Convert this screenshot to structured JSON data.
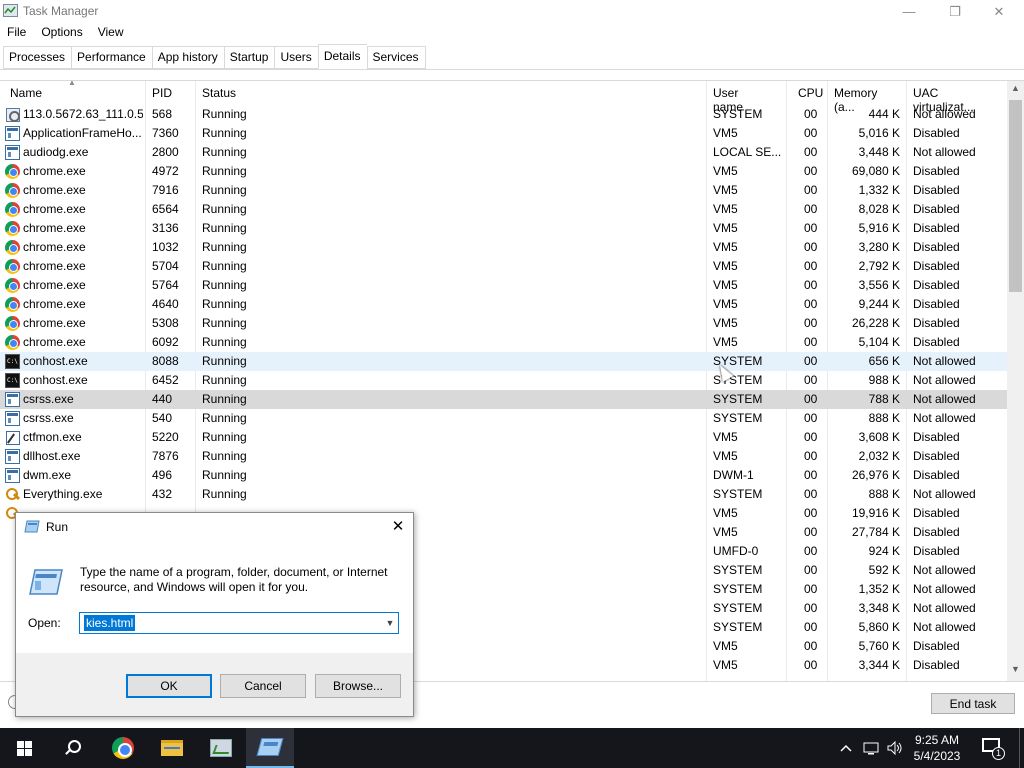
{
  "window": {
    "title": "Task Manager",
    "controls": {
      "minimize": "—",
      "maximize": "❐",
      "close": "✕"
    }
  },
  "menu": [
    "File",
    "Options",
    "View"
  ],
  "tabs": [
    "Processes",
    "Performance",
    "App history",
    "Startup",
    "Users",
    "Details",
    "Services"
  ],
  "active_tab": "Details",
  "columns": {
    "name": "Name",
    "pid": "PID",
    "status": "Status",
    "user": "User name",
    "cpu": "CPU",
    "memory": "Memory (a...",
    "uac": "UAC virtualizat..."
  },
  "rows": [
    {
      "icon": "gear",
      "name": "113.0.5672.63_111.0.5...",
      "pid": "568",
      "status": "Running",
      "user": "SYSTEM",
      "cpu": "00",
      "mem": "444 K",
      "uac": "Not allowed"
    },
    {
      "icon": "win",
      "name": "ApplicationFrameHo...",
      "pid": "7360",
      "status": "Running",
      "user": "VM5",
      "cpu": "00",
      "mem": "5,016 K",
      "uac": "Disabled"
    },
    {
      "icon": "win",
      "name": "audiodg.exe",
      "pid": "2800",
      "status": "Running",
      "user": "LOCAL SE...",
      "cpu": "00",
      "mem": "3,448 K",
      "uac": "Not allowed"
    },
    {
      "icon": "chrome",
      "name": "chrome.exe",
      "pid": "4972",
      "status": "Running",
      "user": "VM5",
      "cpu": "00",
      "mem": "69,080 K",
      "uac": "Disabled"
    },
    {
      "icon": "chrome",
      "name": "chrome.exe",
      "pid": "7916",
      "status": "Running",
      "user": "VM5",
      "cpu": "00",
      "mem": "1,332 K",
      "uac": "Disabled"
    },
    {
      "icon": "chrome",
      "name": "chrome.exe",
      "pid": "6564",
      "status": "Running",
      "user": "VM5",
      "cpu": "00",
      "mem": "8,028 K",
      "uac": "Disabled"
    },
    {
      "icon": "chrome",
      "name": "chrome.exe",
      "pid": "3136",
      "status": "Running",
      "user": "VM5",
      "cpu": "00",
      "mem": "5,916 K",
      "uac": "Disabled"
    },
    {
      "icon": "chrome",
      "name": "chrome.exe",
      "pid": "1032",
      "status": "Running",
      "user": "VM5",
      "cpu": "00",
      "mem": "3,280 K",
      "uac": "Disabled"
    },
    {
      "icon": "chrome",
      "name": "chrome.exe",
      "pid": "5704",
      "status": "Running",
      "user": "VM5",
      "cpu": "00",
      "mem": "2,792 K",
      "uac": "Disabled"
    },
    {
      "icon": "chrome",
      "name": "chrome.exe",
      "pid": "5764",
      "status": "Running",
      "user": "VM5",
      "cpu": "00",
      "mem": "3,556 K",
      "uac": "Disabled"
    },
    {
      "icon": "chrome",
      "name": "chrome.exe",
      "pid": "4640",
      "status": "Running",
      "user": "VM5",
      "cpu": "00",
      "mem": "9,244 K",
      "uac": "Disabled"
    },
    {
      "icon": "chrome",
      "name": "chrome.exe",
      "pid": "5308",
      "status": "Running",
      "user": "VM5",
      "cpu": "00",
      "mem": "26,228 K",
      "uac": "Disabled"
    },
    {
      "icon": "chrome",
      "name": "chrome.exe",
      "pid": "6092",
      "status": "Running",
      "user": "VM5",
      "cpu": "00",
      "mem": "5,104 K",
      "uac": "Disabled"
    },
    {
      "icon": "console",
      "name": "conhost.exe",
      "pid": "8088",
      "status": "Running",
      "user": "SYSTEM",
      "cpu": "00",
      "mem": "656 K",
      "uac": "Not allowed",
      "state": "hover"
    },
    {
      "icon": "console",
      "name": "conhost.exe",
      "pid": "6452",
      "status": "Running",
      "user": "SYSTEM",
      "cpu": "00",
      "mem": "988 K",
      "uac": "Not allowed"
    },
    {
      "icon": "win",
      "name": "csrss.exe",
      "pid": "440",
      "status": "Running",
      "user": "SYSTEM",
      "cpu": "00",
      "mem": "788 K",
      "uac": "Not allowed",
      "state": "selected"
    },
    {
      "icon": "win",
      "name": "csrss.exe",
      "pid": "540",
      "status": "Running",
      "user": "SYSTEM",
      "cpu": "00",
      "mem": "888 K",
      "uac": "Not allowed"
    },
    {
      "icon": "pen",
      "name": "ctfmon.exe",
      "pid": "5220",
      "status": "Running",
      "user": "VM5",
      "cpu": "00",
      "mem": "3,608 K",
      "uac": "Disabled"
    },
    {
      "icon": "win",
      "name": "dllhost.exe",
      "pid": "7876",
      "status": "Running",
      "user": "VM5",
      "cpu": "00",
      "mem": "2,032 K",
      "uac": "Disabled"
    },
    {
      "icon": "win",
      "name": "dwm.exe",
      "pid": "496",
      "status": "Running",
      "user": "DWM-1",
      "cpu": "00",
      "mem": "26,976 K",
      "uac": "Disabled"
    },
    {
      "icon": "key",
      "name": "Everything.exe",
      "pid": "432",
      "status": "Running",
      "user": "SYSTEM",
      "cpu": "00",
      "mem": "888 K",
      "uac": "Not allowed"
    },
    {
      "icon": "key",
      "name": "",
      "pid": "",
      "status": "",
      "user": "VM5",
      "cpu": "00",
      "mem": "19,916 K",
      "uac": "Disabled"
    },
    {
      "icon": "",
      "name": "",
      "pid": "",
      "status": "",
      "user": "VM5",
      "cpu": "00",
      "mem": "27,784 K",
      "uac": "Disabled"
    },
    {
      "icon": "",
      "name": "",
      "pid": "",
      "status": "",
      "user": "UMFD-0",
      "cpu": "00",
      "mem": "924 K",
      "uac": "Disabled"
    },
    {
      "icon": "",
      "name": "",
      "pid": "",
      "status": "",
      "user": "SYSTEM",
      "cpu": "00",
      "mem": "592 K",
      "uac": "Not allowed"
    },
    {
      "icon": "",
      "name": "",
      "pid": "",
      "status": "",
      "user": "SYSTEM",
      "cpu": "00",
      "mem": "1,352 K",
      "uac": "Not allowed"
    },
    {
      "icon": "",
      "name": "",
      "pid": "",
      "status": "",
      "user": "SYSTEM",
      "cpu": "00",
      "mem": "3,348 K",
      "uac": "Not allowed"
    },
    {
      "icon": "",
      "name": "",
      "pid": "",
      "status": "",
      "user": "SYSTEM",
      "cpu": "00",
      "mem": "5,860 K",
      "uac": "Not allowed"
    },
    {
      "icon": "",
      "name": "",
      "pid": "",
      "status": "",
      "user": "VM5",
      "cpu": "00",
      "mem": "5,760 K",
      "uac": "Disabled"
    },
    {
      "icon": "",
      "name": "",
      "pid": "",
      "status": "",
      "user": "VM5",
      "cpu": "00",
      "mem": "3,344 K",
      "uac": "Disabled"
    }
  ],
  "end_task_label": "End task",
  "run_dialog": {
    "title": "Run",
    "close_glyph": "✕",
    "description": "Type the name of a program, folder, document, or Internet resource, and Windows will open it for you.",
    "open_label": "Open:",
    "open_value": "kies.html",
    "dropdown_glyph": "▼",
    "ok_label": "OK",
    "cancel_label": "Cancel",
    "browse_label": "Browse..."
  },
  "taskbar": {
    "time": "9:25 AM",
    "date": "5/4/2023",
    "notification_count": "1"
  },
  "scroll_arrows": {
    "up": "▲",
    "down": "▼"
  }
}
